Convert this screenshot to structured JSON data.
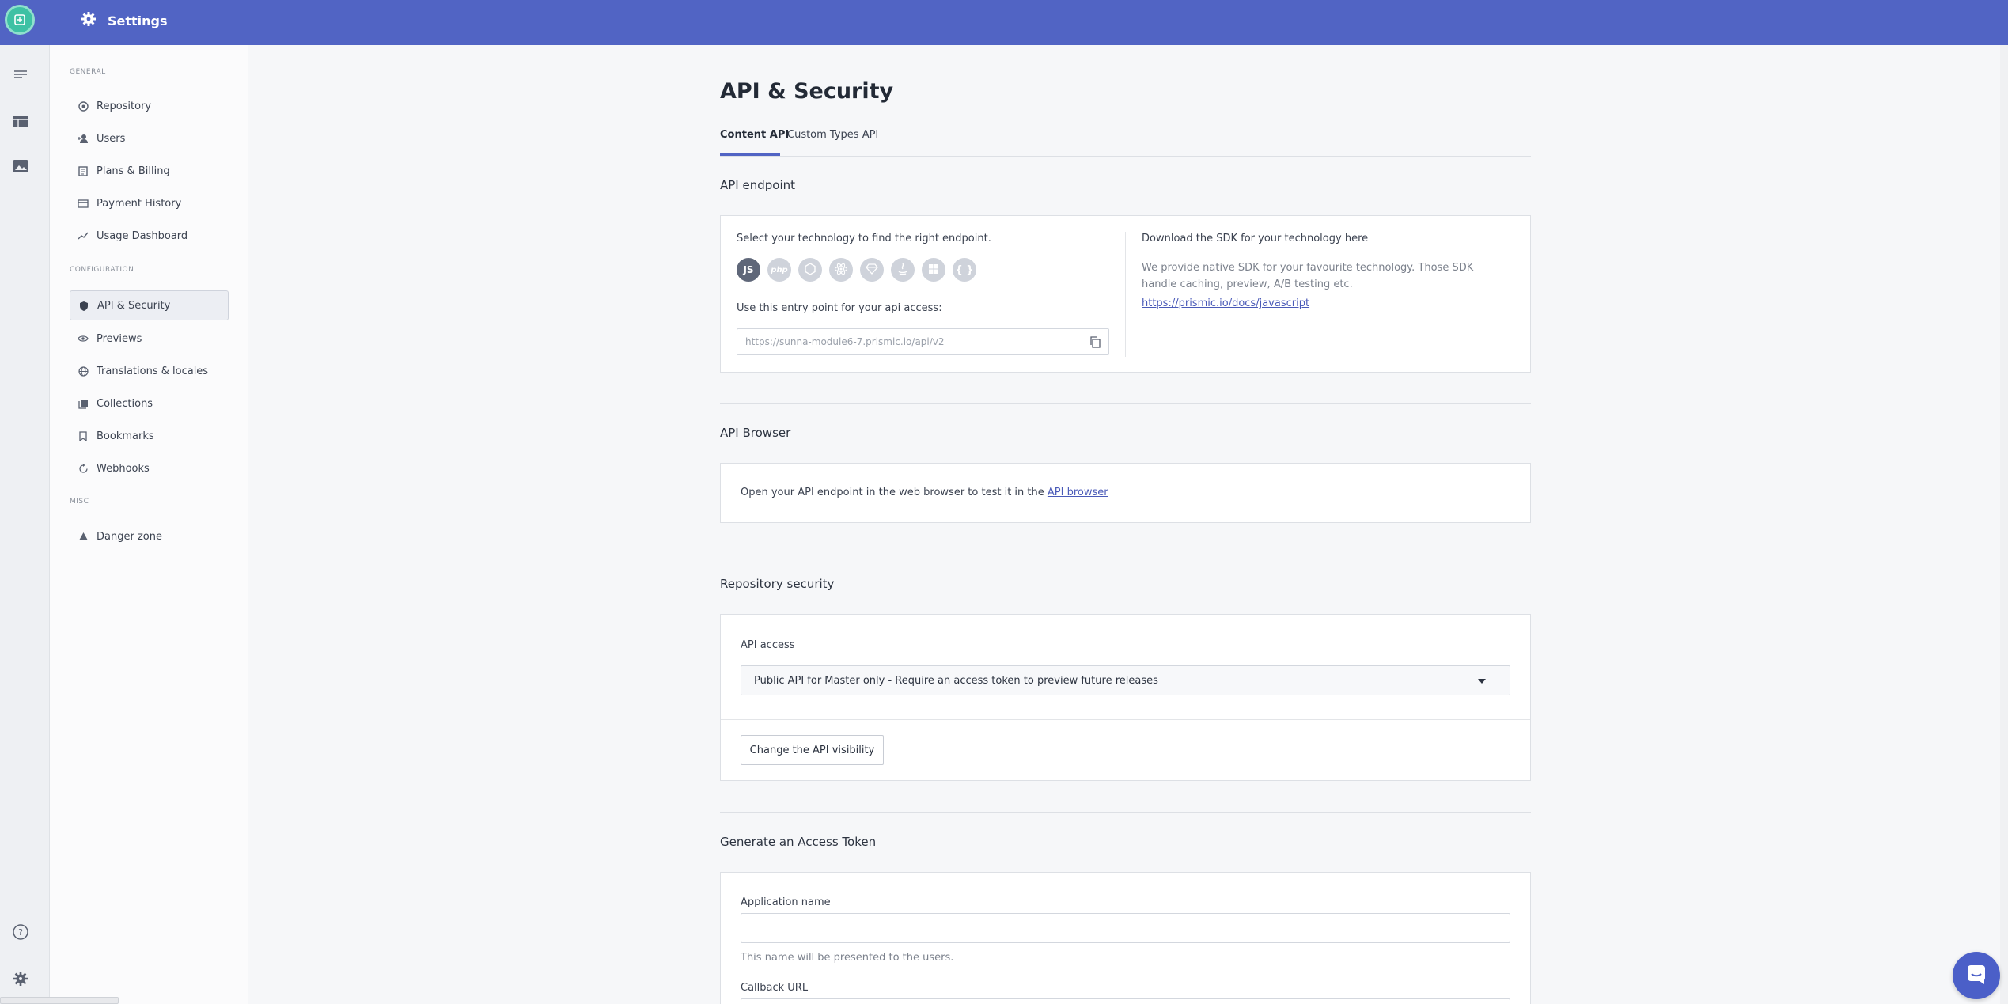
{
  "header": {
    "title": "Settings"
  },
  "sidebar": {
    "general_title": "GENERAL",
    "configuration_title": "CONFIGURATION",
    "misc_title": "MISC",
    "general_items": [
      {
        "label": "Repository",
        "icon": "repository-icon"
      },
      {
        "label": "Users",
        "icon": "add-user-icon"
      },
      {
        "label": "Plans & Billing",
        "icon": "billing-icon"
      },
      {
        "label": "Payment History",
        "icon": "credit-card-icon"
      },
      {
        "label": "Usage Dashboard",
        "icon": "chart-line-icon"
      }
    ],
    "configuration_items": [
      {
        "label": "API & Security",
        "icon": "shield-icon"
      },
      {
        "label": "Previews",
        "icon": "eye-icon"
      },
      {
        "label": "Translations & locales",
        "icon": "globe-icon"
      },
      {
        "label": "Collections",
        "icon": "collections-icon"
      },
      {
        "label": "Bookmarks",
        "icon": "bookmark-icon"
      },
      {
        "label": "Webhooks",
        "icon": "webhook-icon"
      }
    ],
    "misc_items": [
      {
        "label": "Danger zone",
        "icon": "warning-icon"
      }
    ]
  },
  "main": {
    "title": "API & Security",
    "tabs": [
      {
        "label": "Content API",
        "active": true
      },
      {
        "label": "Custom Types API",
        "active": false
      }
    ],
    "api_endpoint": {
      "section_title": "API endpoint",
      "select_text": "Select your technology to find the right endpoint.",
      "technologies": [
        "JS",
        "php",
        "node",
        "react",
        "ruby",
        "java",
        "windows",
        "json"
      ],
      "entry_label": "Use this entry point for your api access:",
      "endpoint_url": "https://sunna-module6-7.prismic.io/api/v2",
      "sdk_title": "Download the SDK for your technology here",
      "sdk_text": "We provide native SDK for your favourite technology. Those SDK handle caching, preview, A/B testing etc.",
      "sdk_link": "https://prismic.io/docs/javascript"
    },
    "api_browser": {
      "section_title": "API Browser",
      "text": "Open your API endpoint in the web browser to test it in the",
      "link": "API browser"
    },
    "repo_security": {
      "section_title": "Repository security",
      "label": "API access",
      "selected": "Public API for Master only - Require an access token to preview future releases",
      "button": "Change the API visibility"
    },
    "access_token": {
      "section_title": "Generate an Access Token",
      "app_name_label": "Application name",
      "app_name_value": "",
      "app_name_hint": "This name will be presented to the users.",
      "callback_label": "Callback URL"
    }
  }
}
